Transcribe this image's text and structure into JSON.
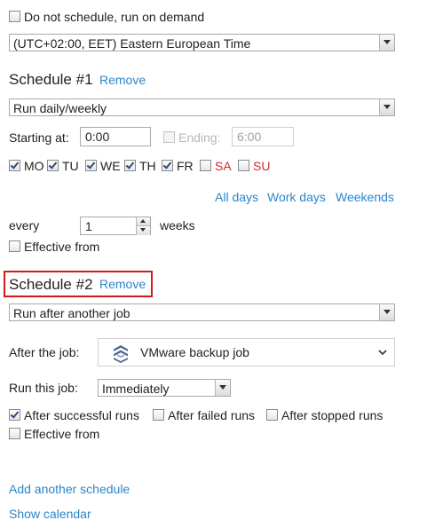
{
  "general": {
    "on_demand_label": "Do not schedule, run on demand",
    "on_demand_checked": false,
    "timezone": "(UTC+02:00, EET) Eastern European Time"
  },
  "schedule1": {
    "title": "Schedule #1",
    "remove": "Remove",
    "type": "Run daily/weekly",
    "starting_label": "Starting at:",
    "starting_value": "0:00",
    "ending_label": "Ending:",
    "ending_value": "6:00",
    "days": [
      {
        "label": "MO",
        "checked": true
      },
      {
        "label": "TU",
        "checked": true
      },
      {
        "label": "WE",
        "checked": true
      },
      {
        "label": "TH",
        "checked": true
      },
      {
        "label": "FR",
        "checked": true
      },
      {
        "label": "SA",
        "checked": false
      },
      {
        "label": "SU",
        "checked": false
      }
    ],
    "all_days": "All days",
    "work_days": "Work days",
    "weekends": "Weekends",
    "every_label": "every",
    "every_value": "1",
    "every_unit": "weeks",
    "effective_from": "Effective from"
  },
  "schedule2": {
    "title": "Schedule #2",
    "remove": "Remove",
    "type": "Run after another job",
    "after_job_label": "After the job:",
    "after_job_value": "VMware backup job",
    "run_this_label": "Run this job:",
    "run_this_value": "Immediately",
    "after_successful": "After successful runs",
    "after_failed": "After failed runs",
    "after_stopped": "After stopped runs",
    "effective_from": "Effective from"
  },
  "footer": {
    "add_schedule": "Add another schedule",
    "show_calendar": "Show calendar"
  },
  "colors": {
    "link": "#2a86c9",
    "weekend_red": "#d42a2a",
    "highlight_border": "#d01c1c"
  }
}
